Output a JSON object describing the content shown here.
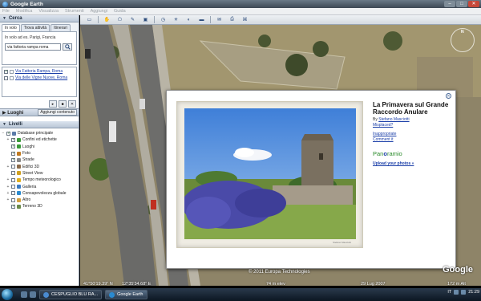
{
  "window": {
    "title": "Google Earth",
    "controls": [
      "–",
      "□",
      "✕"
    ]
  },
  "menu": [
    "File",
    "Modifica",
    "Visualizza",
    "Strumenti",
    "Aggiungi",
    "Guida"
  ],
  "search": {
    "header": "Cerca",
    "tabs": [
      "In volo",
      "Trova attività",
      "Itinerari"
    ],
    "hint": "In volo ad es. Parigi, Francia",
    "value": "via fattoria rampa roma",
    "results": [
      {
        "label": "Via Fattoria Rampa, Roma",
        "checked": true
      },
      {
        "label": "Via delle Vigne Nuove, Roma",
        "checked": false
      }
    ],
    "controls": [
      "▸",
      "■",
      "✕"
    ]
  },
  "places": {
    "header": "Luoghi",
    "add_content": "Aggiungi contenuto"
  },
  "layers": {
    "header": "Livelli",
    "items": [
      {
        "label": "Database principale",
        "expander": "−",
        "color": "#5a7aa8",
        "checked": true
      },
      {
        "label": "Confini ed etichette",
        "expander": "+",
        "color": "#3a9a3a",
        "checked": true
      },
      {
        "label": "Luoghi",
        "expander": "",
        "color": "#3a9a3a",
        "checked": true
      },
      {
        "label": "Foto",
        "expander": "",
        "color": "#c07a20",
        "checked": true
      },
      {
        "label": "Strade",
        "expander": "",
        "color": "#888888",
        "checked": true
      },
      {
        "label": "Edifici 3D",
        "expander": "+",
        "color": "#8a6a4a",
        "checked": false
      },
      {
        "label": "Street View",
        "expander": "",
        "color": "#d0a020",
        "checked": false
      },
      {
        "label": "Tempo meteorologico",
        "expander": "+",
        "color": "#e0b020",
        "checked": false
      },
      {
        "label": "Galleria",
        "expander": "+",
        "color": "#3a7ac0",
        "checked": false
      },
      {
        "label": "Consapevolezza globale",
        "expander": "+",
        "color": "#2a8ad0",
        "checked": false
      },
      {
        "label": "Altro",
        "expander": "+",
        "color": "#d0a040",
        "checked": false
      },
      {
        "label": "Terreno 3D",
        "expander": "",
        "color": "#6a8a4a",
        "checked": true
      }
    ]
  },
  "toolbar": {
    "tools": [
      {
        "name": "sidebar-toggle-icon",
        "glyph": "▭"
      },
      {
        "name": "placemark-icon",
        "glyph": "✋"
      },
      {
        "name": "polygon-icon",
        "glyph": "⬠"
      },
      {
        "name": "path-icon",
        "glyph": "✎"
      },
      {
        "name": "overlay-icon",
        "glyph": "▣"
      },
      {
        "name": "history-icon",
        "glyph": "◷"
      },
      {
        "name": "sun-icon",
        "glyph": "☀"
      },
      {
        "name": "planets-icon",
        "glyph": "◐"
      },
      {
        "name": "ruler-icon",
        "glyph": "▬"
      },
      {
        "name": "email-icon",
        "glyph": "✉"
      },
      {
        "name": "print-icon",
        "glyph": "⎙"
      },
      {
        "name": "maps-icon",
        "glyph": "⌘"
      }
    ]
  },
  "navigation": {
    "north": "N"
  },
  "infowindow": {
    "title": "La Primavera sul Grande Raccordo Anulare",
    "by_prefix": "By",
    "author": "Stefano Masciotti",
    "misplaced": "Misplaced?",
    "inappropriate": "Inappropriate",
    "comments": "Comment it",
    "brand_a": "Pan",
    "brand_b": "o",
    "brand_c": "ramio",
    "upload": "Upload your photos »",
    "photo_credit": "Stefano Masciotti"
  },
  "map": {
    "copyright": "© 2011 Europa Technologies",
    "logo": "Google",
    "coords": "41°50'19.39\" N",
    "coords2": "12°35'34.68\" E",
    "elev": "74 m elev",
    "date": "29 Lug 2007",
    "alt": "172 m Alt"
  },
  "taskbar": {
    "items": [
      {
        "label": "CESPUGLIO BLU RA...",
        "color": "#4a8ad0",
        "active": false
      },
      {
        "label": "Google Earth",
        "color": "#2a8ad0",
        "active": true
      }
    ],
    "lang": "IT",
    "clock": "21:29"
  }
}
